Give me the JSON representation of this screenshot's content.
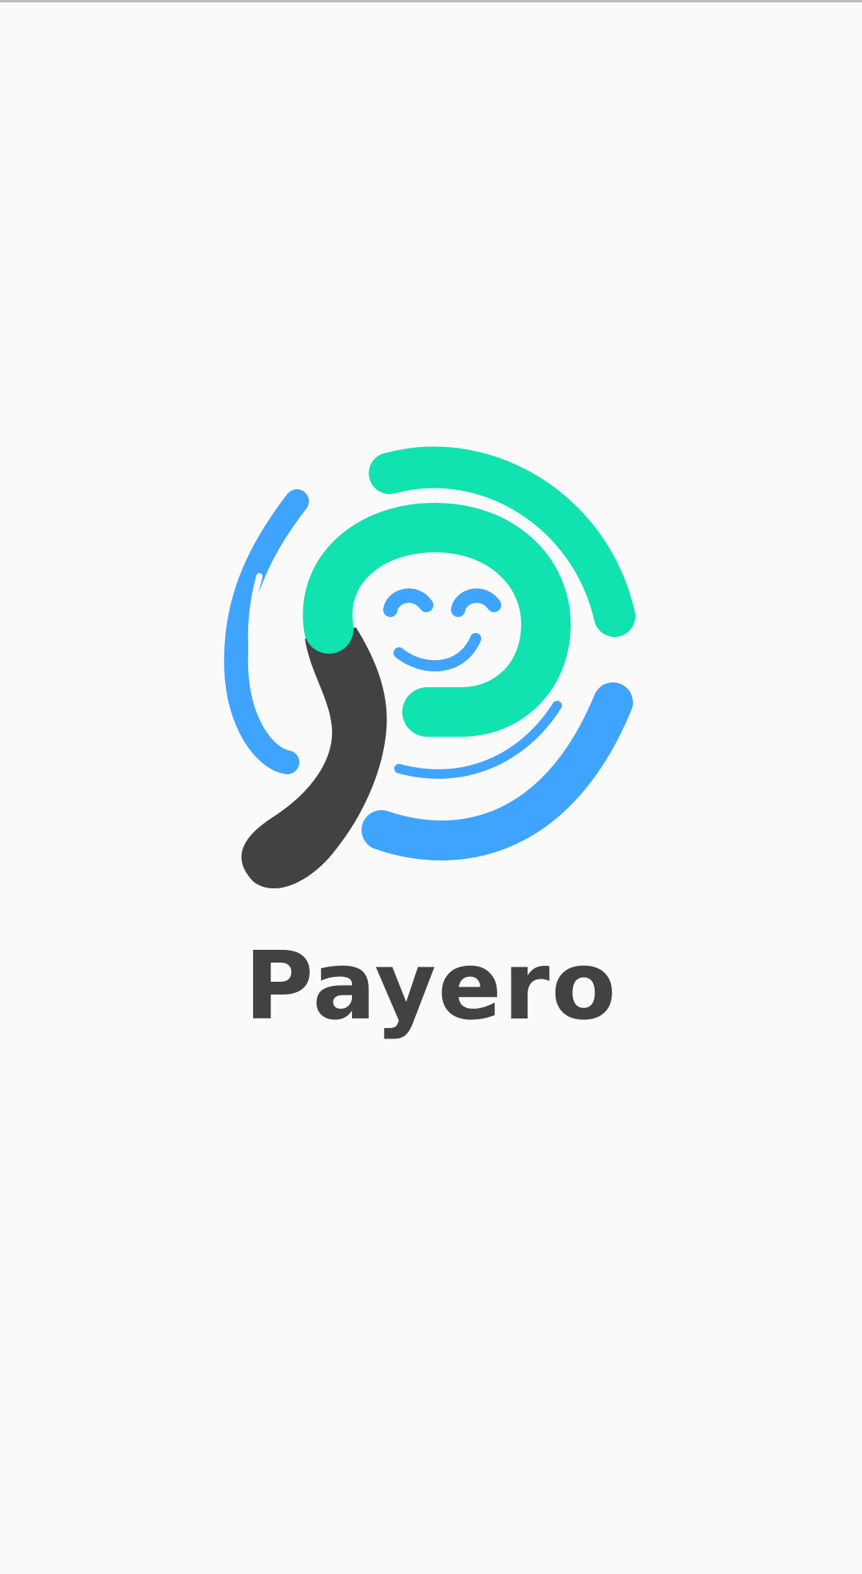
{
  "app": {
    "name": "Payero"
  },
  "logo": {
    "icon": "smiley-face-swirl-icon",
    "colors": {
      "green": "#10e2b0",
      "blue": "#3fa4fd",
      "dark": "#424242"
    }
  },
  "colors": {
    "background": "#fafafa",
    "text": "#424242"
  }
}
